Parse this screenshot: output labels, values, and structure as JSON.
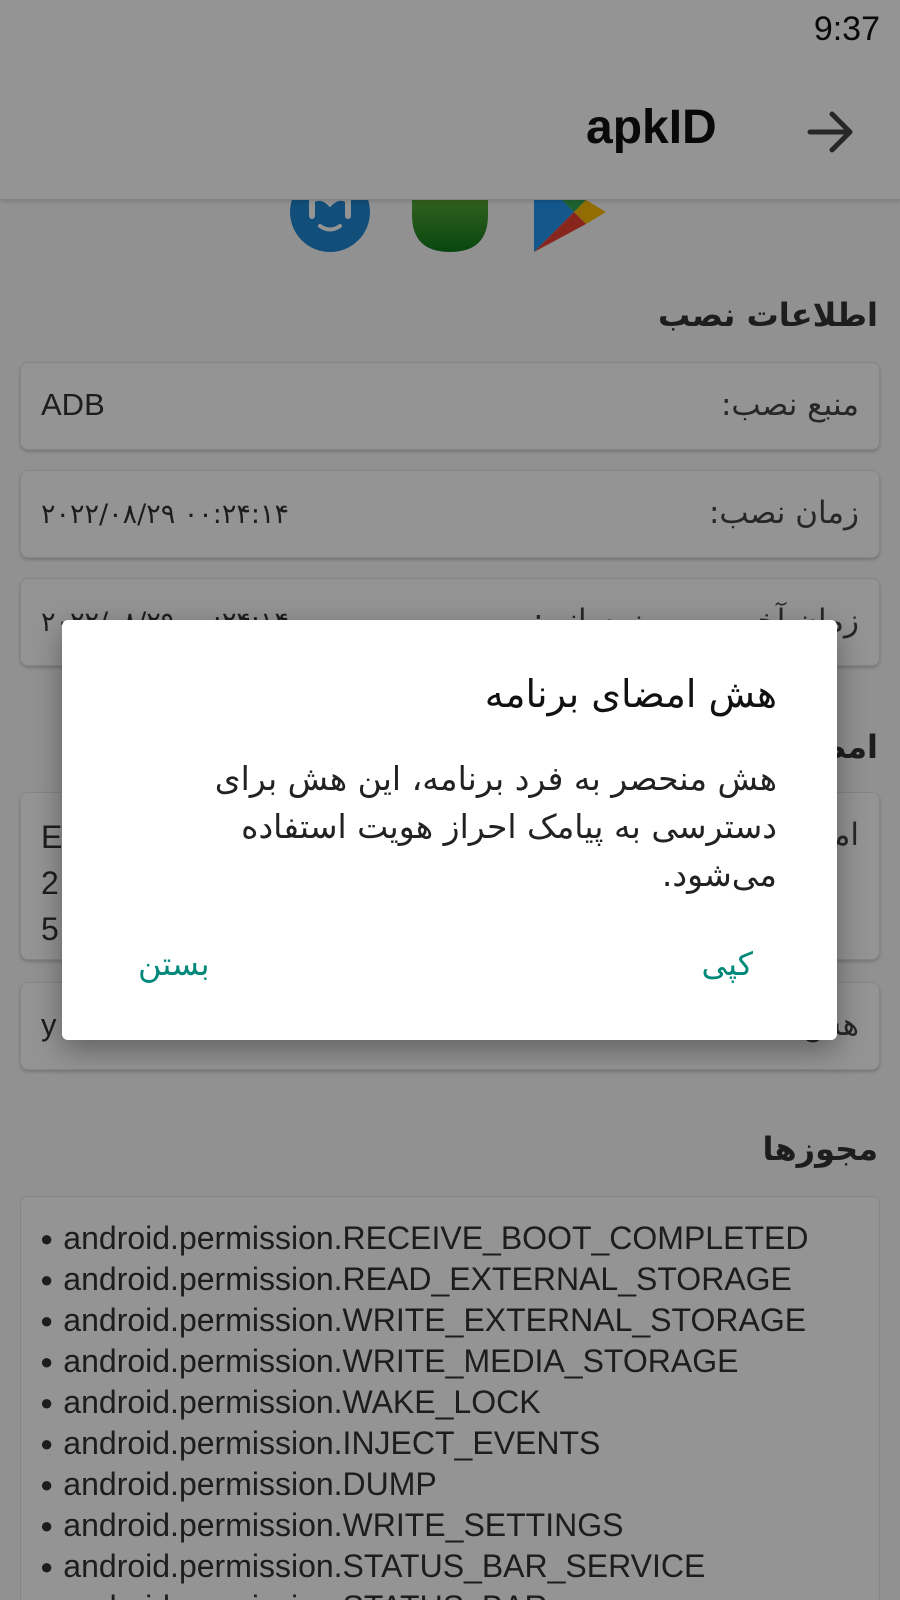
{
  "status_bar": {
    "time": "9:37"
  },
  "app_bar": {
    "title": "apkID"
  },
  "install_info": {
    "title": "اطلاعات نصب",
    "rows": [
      {
        "label": "منبع نصب:",
        "value": "ADB"
      },
      {
        "label": "زمان نصب:",
        "value": "۲۰۲۲/۰۸/۲۹ ۰۰:۲۴:۱۴"
      },
      {
        "label": "زمان آخرین بهروزرسانی:",
        "value": "۲۰۲۲/۰۸/۲۹ ۰۰:۲۴:۱۴"
      }
    ]
  },
  "signature": {
    "title": "امضا",
    "row1_label": "امضا",
    "row1_value_lines": [
      "E",
      "2",
      "5"
    ],
    "row2_label": "هش",
    "row2_value": "y"
  },
  "permissions": {
    "title": "مجوزها",
    "items": [
      "android.permission.RECEIVE_BOOT_COMPLETED",
      "android.permission.READ_EXTERNAL_STORAGE",
      "android.permission.WRITE_EXTERNAL_STORAGE",
      "android.permission.WRITE_MEDIA_STORAGE",
      "android.permission.WAKE_LOCK",
      "android.permission.INJECT_EVENTS",
      "android.permission.DUMP",
      "android.permission.WRITE_SETTINGS",
      "android.permission.STATUS_BAR_SERVICE",
      "android.permission.STATUS_BAR"
    ]
  },
  "dialog": {
    "title": "هش امضای برنامه",
    "message": "هش منحصر به فرد برنامه، این هش برای دسترسی به پیامک احراز هویت استفاده می‌شود.",
    "copy_label": "کپی",
    "close_label": "بستن"
  },
  "colors": {
    "accent": "#00897b",
    "scrim": "rgba(0,0,0,0.42)"
  },
  "icons": [
    "myket-store-icon",
    "green-store-icon",
    "google-play-icon",
    "back-arrow-icon"
  ]
}
